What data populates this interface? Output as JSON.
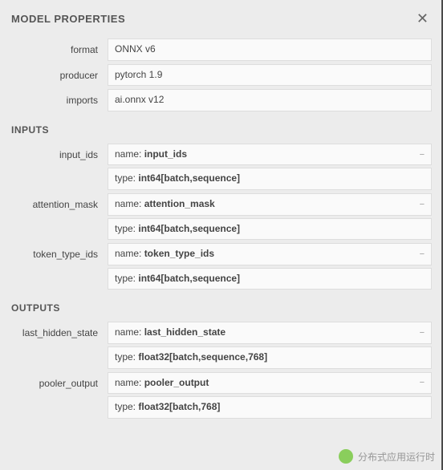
{
  "header": {
    "title": "MODEL PROPERTIES"
  },
  "basic": {
    "format_label": "format",
    "format_value": "ONNX v6",
    "producer_label": "producer",
    "producer_value": "pytorch 1.9",
    "imports_label": "imports",
    "imports_value": "ai.onnx v12"
  },
  "sections": {
    "inputs_title": "INPUTS",
    "outputs_title": "OUTPUTS"
  },
  "labels": {
    "name_prefix": "name: ",
    "type_prefix": "type: "
  },
  "inputs": [
    {
      "label": "input_ids",
      "name": "input_ids",
      "type": "int64[batch,sequence]"
    },
    {
      "label": "attention_mask",
      "name": "attention_mask",
      "type": "int64[batch,sequence]"
    },
    {
      "label": "token_type_ids",
      "name": "token_type_ids",
      "type": "int64[batch,sequence]"
    }
  ],
  "outputs": [
    {
      "label": "last_hidden_state",
      "name": "last_hidden_state",
      "type": "float32[batch,sequence,768]"
    },
    {
      "label": "pooler_output",
      "name": "pooler_output",
      "type": "float32[batch,768]"
    }
  ],
  "watermark": {
    "text": "分布式应用运行时"
  }
}
